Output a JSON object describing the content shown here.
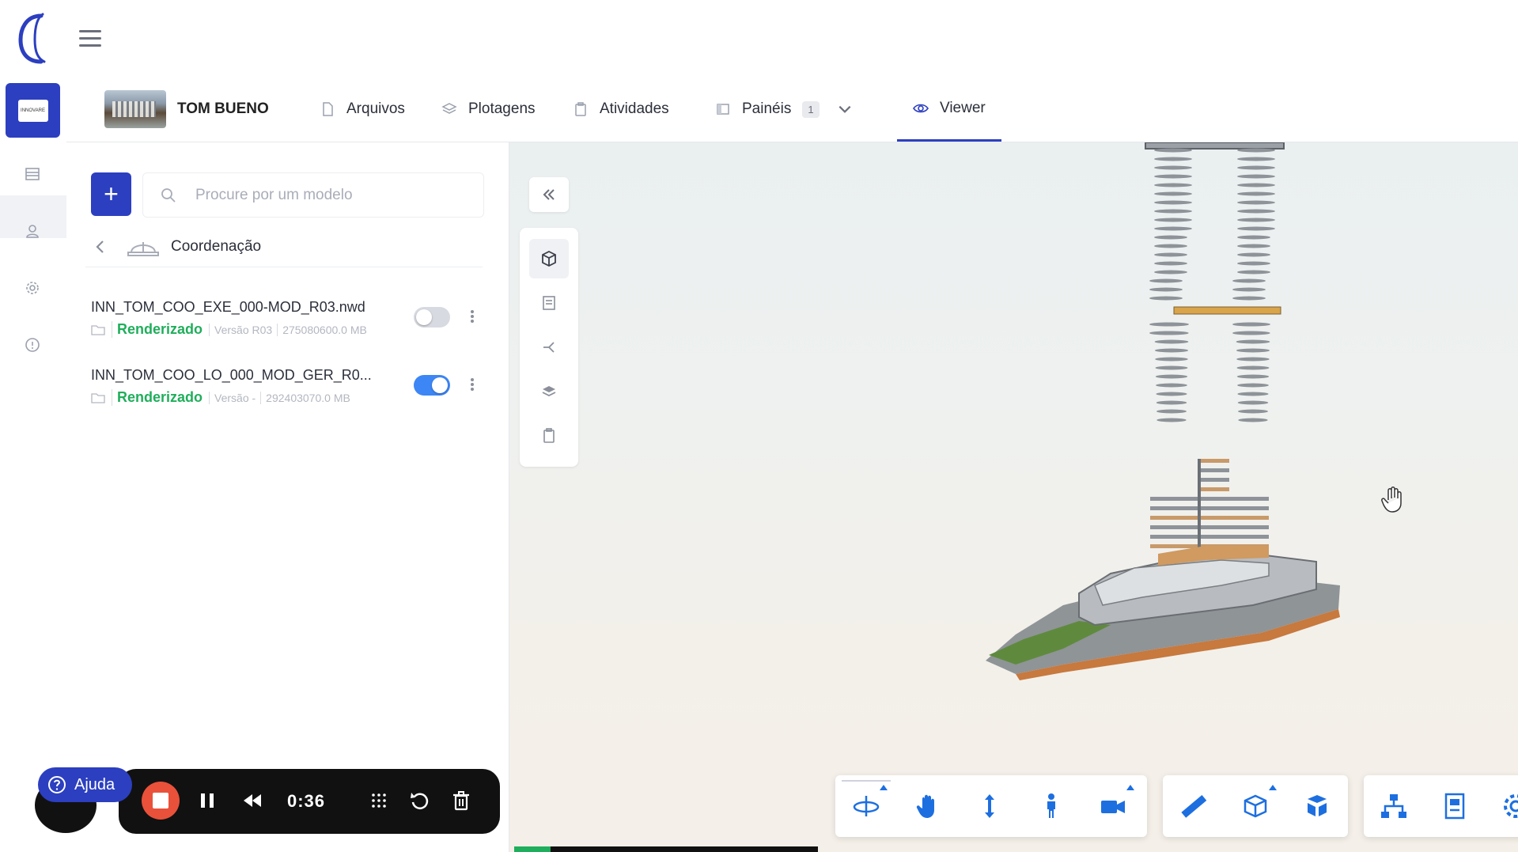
{
  "header": {
    "menu_icon": "hamburger-icon"
  },
  "project": {
    "name": "TOM BUENO",
    "thumb_label": "INNOVARE"
  },
  "tabs": [
    {
      "label": "Arquivos",
      "icon": "file-icon"
    },
    {
      "label": "Plotagens",
      "icon": "layers-icon"
    },
    {
      "label": "Atividades",
      "icon": "clipboard-icon"
    },
    {
      "label": "Painéis",
      "icon": "panel-icon",
      "badge": "1"
    },
    {
      "label": "Viewer",
      "icon": "eye-icon",
      "active": true
    }
  ],
  "sidebar_panel": {
    "search_placeholder": "Procure por um modelo",
    "breadcrumb": "Coordenação",
    "models": [
      {
        "name": "INN_TOM_COO_EXE_000-MOD_R03.nwd",
        "status": "Renderizado",
        "version": "Versão R03",
        "size": "275080600.0 MB",
        "enabled": false
      },
      {
        "name": "INN_TOM_COO_LO_000_MOD_GER_R0...",
        "status": "Renderizado",
        "version": "Versão -",
        "size": "292403070.0 MB",
        "enabled": true
      }
    ]
  },
  "recorder": {
    "time": "0:36",
    "help_label": "Ajuda",
    "progress": 0.12
  },
  "colors": {
    "primary": "#2c3fc0",
    "success": "#1fae5b",
    "toggle_on": "#3d86f5",
    "stop": "#e9513a"
  }
}
